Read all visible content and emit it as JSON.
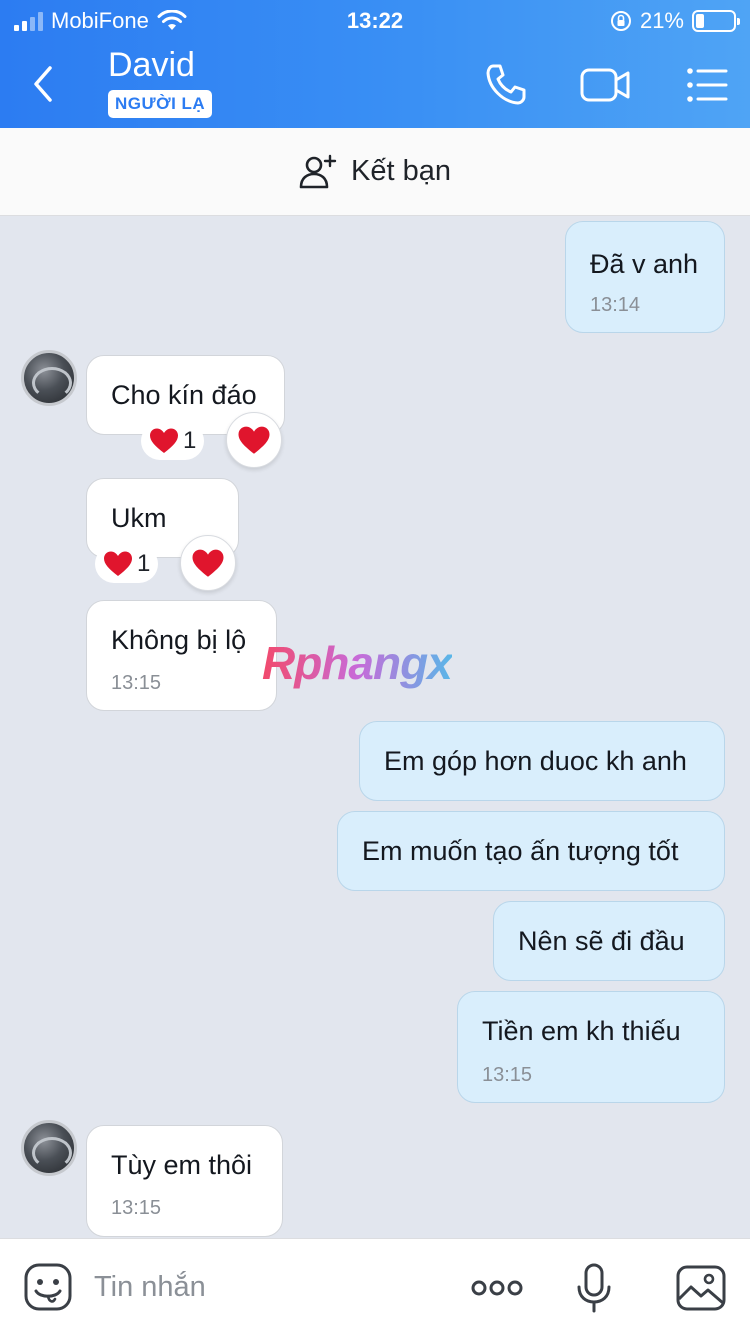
{
  "status_bar": {
    "carrier": "MobiFone",
    "time": "13:22",
    "battery": "21%"
  },
  "header": {
    "contact_name": "David",
    "badge": "NGƯỜI LẠ"
  },
  "friend_bar": {
    "label": "Kết bạn"
  },
  "messages": [
    {
      "side": "out",
      "text": "Đã v anh",
      "time": "13:14"
    },
    {
      "side": "in",
      "text": "Cho kín đáo",
      "reaction": "1"
    },
    {
      "side": "in",
      "text": "Ukm",
      "reaction": "1"
    },
    {
      "side": "in",
      "text": "Không bị lộ",
      "time": "13:15"
    },
    {
      "side": "out",
      "text": "Em góp hơn duoc kh anh"
    },
    {
      "side": "out",
      "text": "Em muốn tạo ấn tượng tốt"
    },
    {
      "side": "out",
      "text": "Nên sẽ đi đầu"
    },
    {
      "side": "out",
      "text": "Tiền em kh thiếu",
      "time": "13:15"
    },
    {
      "side": "in",
      "text": "Tùy em thôi",
      "time": "13:15"
    }
  ],
  "watermark": "Rphangx",
  "input": {
    "placeholder": "Tin nhắn"
  },
  "colors": {
    "header_start": "#2c7cf2",
    "header_end": "#4fa4f5",
    "outgoing_bubble": "#d9eefc",
    "incoming_bubble": "#ffffff",
    "chat_bg": "#e2e6ee"
  }
}
